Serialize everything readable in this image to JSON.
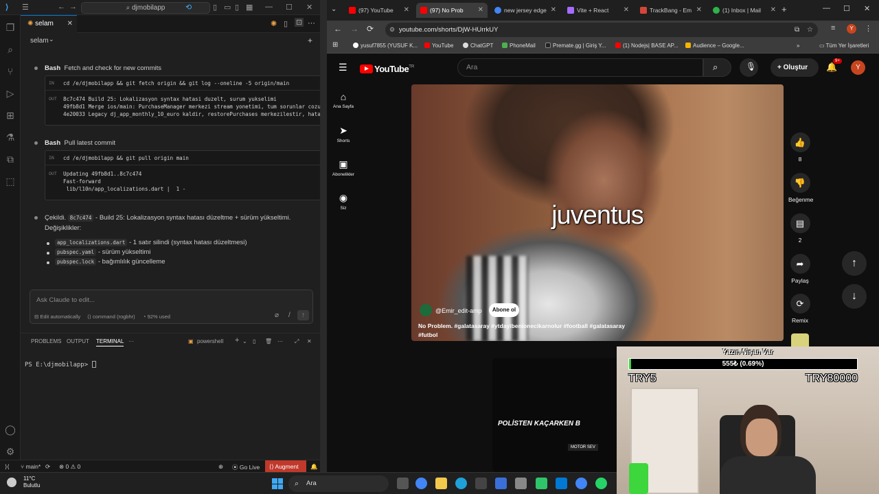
{
  "vscode": {
    "search_text": "djmobilapp",
    "tab_label": "selam",
    "chat_title": "selam",
    "blocks": [
      {
        "kind": "Bash",
        "title": "Fetch and check for new commits",
        "command": "cd /e/djmobilapp && git fetch origin && git log --oneline -5 origin/main",
        "output": [
          "8c7c474 Build 25: Lokalizasyon syntax hatasi duzelt, surum yukselimi",
          "49fb8d1 Merge ios/main: PurchaseManager merkezi stream yonetimi, tum sorunlar cozuldu",
          "4e20033 Legacy dj_app_monthly_10_euro kaldir, restorePurchases merkezilestir, hata me"
        ]
      },
      {
        "kind": "Bash",
        "title": "Pull latest commit",
        "command": "cd /e/djmobilapp && git pull origin main",
        "output": [
          "Updating 49fb8d1..8c7c474",
          "Fast-forward",
          " lib/l10n/app_localizations.dart |  1 -"
        ]
      }
    ],
    "summary_lead": "Çekildi.",
    "summary_hash": "8c7c474",
    "summary_text": "- Build 25: Lokalizasyon syntax hatası düzeltme + sürüm yükseltimi.",
    "summary_changes": "Değişiklikler:",
    "changes": [
      {
        "file": "app_localizations.dart",
        "desc": "- 1 satır silindi (syntax hatası düzeltmesi)"
      },
      {
        "file": "pubspec.yaml",
        "desc": "- sürüm yükseltimi"
      },
      {
        "file": "pubspec.lock",
        "desc": "- bağımlılık güncelleme"
      }
    ],
    "ask_placeholder": "Ask Claude to edit...",
    "opt_edit": "Edit automatically",
    "opt_cmd": "command (rogbhr)",
    "opt_used": "92% used",
    "panel_tabs": [
      "PROBLEMS",
      "OUTPUT",
      "TERMINAL",
      "···"
    ],
    "terminal_shell": "powershell",
    "terminal_prompt": "PS E:\\djmobilapp> ",
    "status_branch": "main*",
    "status_errors": "⊗ 0 ⚠ 0",
    "status_golive": "Go Live",
    "status_augment": "Augment"
  },
  "chrome": {
    "tabs": [
      {
        "label": "(97) YouTube",
        "color": "#ff0000"
      },
      {
        "label": "(97) No Prob",
        "color": "#ff0000"
      },
      {
        "label": "new jersey edge",
        "color": "#4285f4"
      },
      {
        "label": "Vite + React",
        "color": "#a66bff"
      },
      {
        "label": "TrackBang - Em",
        "color": "#d44638"
      },
      {
        "label": "(1) Inbox | Mail",
        "color": "#2db34a"
      }
    ],
    "url": "youtube.com/shorts/DjW-HUrrkUY",
    "bookmarks": [
      {
        "label": "yusuf7855 (YUSUF K...",
        "color": "#ffffff"
      },
      {
        "label": "YouTube",
        "color": "#ff0000"
      },
      {
        "label": "ChatGPT",
        "color": "#dddddd"
      },
      {
        "label": "PhoneMail",
        "color": "#4caf50"
      },
      {
        "label": "Premate.gg | Giriş Y...",
        "color": "#222222"
      },
      {
        "label": "(1) Nodejs| BASE AP...",
        "color": "#ff0000"
      },
      {
        "label": "Audience – Google...",
        "color": "#f4b400"
      }
    ],
    "bookmarks_all": "Tüm Yer İşaretleri"
  },
  "youtube": {
    "logo_text": "YouTube",
    "logo_region": "TR",
    "search_placeholder": "Ara",
    "create_label": "Oluştur",
    "bell_badge": "9+",
    "avatar_letter": "Y",
    "nav": [
      {
        "label": "Ana Sayfa",
        "icon": "⌂"
      },
      {
        "label": "Shorts",
        "icon": "➤"
      },
      {
        "label": "Abonelikler",
        "icon": "▣"
      },
      {
        "label": "Siz",
        "icon": "◉"
      }
    ],
    "caption": "juventus",
    "channel": "@Emir_edit-amp",
    "subscribe": "Abone ol",
    "description": "No Problem. #galatasaray #ytdayibenionecikarnolur #football #galatasaray #futbol",
    "actions": [
      {
        "name": "like",
        "icon": "👍",
        "label": "8"
      },
      {
        "name": "dislike",
        "icon": "👎",
        "label": "Beğenme"
      },
      {
        "name": "comments",
        "icon": "▤",
        "label": "2"
      },
      {
        "name": "share",
        "icon": "➦",
        "label": "Paylaş"
      },
      {
        "name": "remix",
        "icon": "⟳",
        "label": "Remix"
      }
    ],
    "next_title": "POLİSTEN KAÇARKEN B",
    "next_tag": "MOTOR SEV"
  },
  "stream": {
    "title": "Yazın Nişan Var",
    "bar_label": "555₺ (0.69%)",
    "progress_fraction": 0.0069,
    "left_label": "TRY5",
    "right_label": "TRY80000"
  },
  "taskbar": {
    "temp": "11°C",
    "weather": "Bulutlu",
    "search": "Ara"
  }
}
